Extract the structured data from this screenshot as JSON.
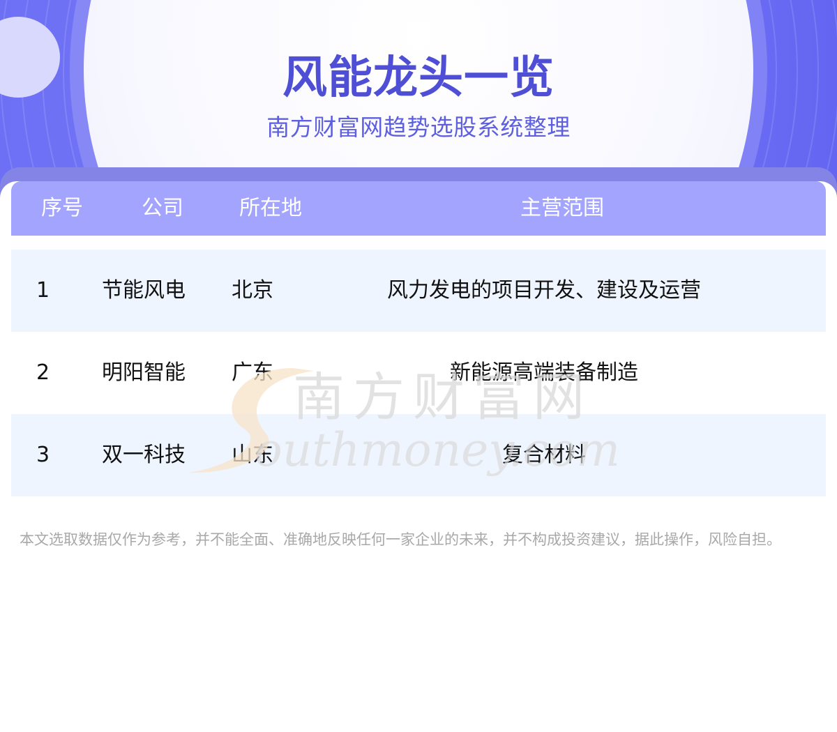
{
  "header": {
    "title": "风能龙头一览",
    "subtitle": "南方财富网趋势选股系统整理"
  },
  "table": {
    "columns": [
      "序号",
      "公司",
      "所在地",
      "主营范围"
    ],
    "rows": [
      {
        "index": "1",
        "company": "节能风电",
        "location": "北京",
        "business": "风力发电的项目开发、建设及运营"
      },
      {
        "index": "2",
        "company": "明阳智能",
        "location": "广东",
        "business": "新能源高端装备制造"
      },
      {
        "index": "3",
        "company": "双一科技",
        "location": "山东",
        "business": "复合材料"
      }
    ]
  },
  "watermark": {
    "cn_text": "南方财富网",
    "en_text": "outhmoney.com"
  },
  "disclaimer": "本文选取数据仅作为参考，并不能全面、准确地反映任何一家企业的未来，并不构成投资建议，据此操作，风险自担。",
  "colors": {
    "header_bg": "#6d6ff5",
    "title": "#4f4fd6",
    "table_head": "#a3a4fd",
    "row_shade": "#eef5fe"
  }
}
